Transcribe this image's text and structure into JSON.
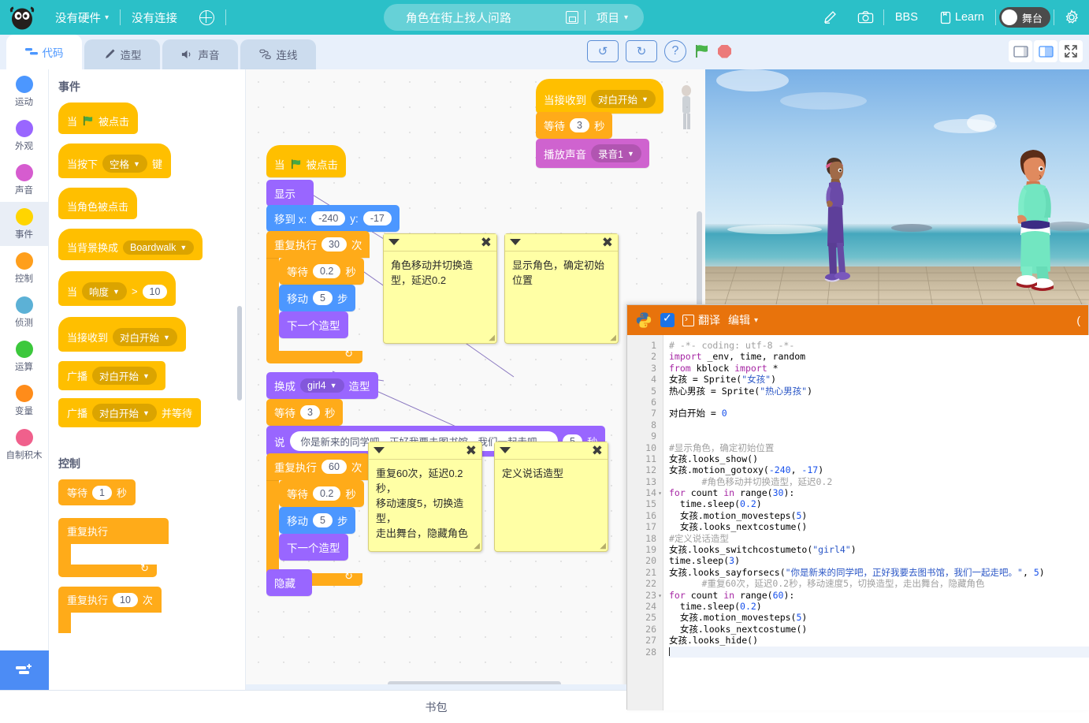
{
  "menubar": {
    "hardware": "没有硬件",
    "connection": "没有连接",
    "globe_icon": "globe-icon",
    "project_title": "角色在街上找人问路",
    "save_icon": "save-icon",
    "project_menu": "项目",
    "edit_icon": "pencil-icon",
    "camera_icon": "camera-icon",
    "bbs": "BBS",
    "learn": "Learn",
    "learn_icon": "book-icon",
    "stage_toggle": "舞台",
    "settings_icon": "gear-icon"
  },
  "tabs": [
    {
      "label": "代码",
      "icon": "code-icon",
      "active": true
    },
    {
      "label": "造型",
      "icon": "brush-icon",
      "active": false
    },
    {
      "label": "声音",
      "icon": "speaker-icon",
      "active": false
    },
    {
      "label": "连线",
      "icon": "link-icon",
      "active": false
    }
  ],
  "center_tools": {
    "undo": "undo-icon",
    "redo": "redo-icon",
    "help": "?",
    "green_flag": "green-flag-icon",
    "stop": "stop-icon"
  },
  "right_tools": {
    "small_stage": "small-stage-icon",
    "large_stage": "large-stage-icon",
    "fullscreen": "fullscreen-icon"
  },
  "categories": [
    {
      "label": "运动",
      "color": "#4c97ff",
      "selected": false
    },
    {
      "label": "外观",
      "color": "#9966ff",
      "selected": false
    },
    {
      "label": "声音",
      "color": "#d65ccf",
      "selected": false
    },
    {
      "label": "事件",
      "color": "#ffd500",
      "selected": true
    },
    {
      "label": "控制",
      "color": "#ff9f1c",
      "selected": false
    },
    {
      "label": "侦测",
      "color": "#5cb1d6",
      "selected": false
    },
    {
      "label": "运算",
      "color": "#3cc83c",
      "selected": false
    },
    {
      "label": "变量",
      "color": "#ff8c1a",
      "selected": false
    },
    {
      "label": "自制积木",
      "color": "#f0608c",
      "selected": false
    }
  ],
  "add_extension_icon": "add-extension-icon",
  "palette": {
    "section_events": "事件",
    "section_control": "控制",
    "blocks": {
      "when_flag": {
        "pre": "当",
        "post": "被点击"
      },
      "when_key": {
        "pre": "当按下",
        "key": "空格",
        "post": "键"
      },
      "when_sprite_clicked": "当角色被点击",
      "when_backdrop": {
        "pre": "当背景换成",
        "value": "Boardwalk"
      },
      "when_loudness": {
        "pre": "当",
        "value": "响度",
        "op": ">",
        "num": "10"
      },
      "when_receive": {
        "pre": "当接收到",
        "value": "对白开始"
      },
      "broadcast": {
        "pre": "广播",
        "value": "对白开始"
      },
      "broadcast_wait": {
        "pre": "广播",
        "value": "对白开始",
        "post": "并等待"
      },
      "wait": {
        "pre": "等待",
        "num": "1",
        "post": "秒"
      },
      "forever": "重复执行",
      "repeat": {
        "pre": "重复执行",
        "num": "10",
        "post": "次"
      }
    }
  },
  "canvas": {
    "script_main": [
      {
        "type": "hat",
        "cls": "ev",
        "pre": "当",
        "flag": true,
        "post": "被点击"
      },
      {
        "type": "look",
        "text": "显示"
      },
      {
        "type": "mot",
        "pre": "移到 x:",
        "x": "-240",
        "mid": "y:",
        "y": "-17"
      },
      {
        "type": "ctl",
        "pre": "重复执行",
        "num": "30",
        "post": "次"
      },
      {
        "type": "ctl",
        "pre": "等待",
        "num": "0.2",
        "post": "秒"
      },
      {
        "type": "mot",
        "pre": "移动",
        "num": "5",
        "post": "步"
      },
      {
        "type": "look",
        "text": "下一个造型"
      },
      {
        "type": "look",
        "pre": "换成",
        "value": "girl4",
        "post": "造型"
      },
      {
        "type": "ctl",
        "pre": "等待",
        "num": "3",
        "post": "秒"
      },
      {
        "type": "look",
        "pre": "说",
        "msg": "你是新来的同学吧，正好我要去图书馆，我们一起走吧。",
        "num": "5",
        "post": "秒"
      },
      {
        "type": "ctl",
        "pre": "重复执行",
        "num": "60",
        "post": "次"
      },
      {
        "type": "ctl",
        "pre": "等待",
        "num": "0.2",
        "post": "秒"
      },
      {
        "type": "mot",
        "pre": "移动",
        "num": "5",
        "post": "步"
      },
      {
        "type": "look",
        "text": "下一个造型"
      },
      {
        "type": "look",
        "text": "隐藏"
      }
    ],
    "script_sound": {
      "hat_pre": "当接收到",
      "hat_value": "对白开始",
      "wait_pre": "等待",
      "wait_num": "3",
      "wait_post": "秒",
      "play_pre": "播放声音",
      "play_value": "录音1"
    },
    "comments": [
      {
        "text": "角色移动并切换造型，延迟0.2"
      },
      {
        "text": "显示角色，确定初始位置"
      },
      {
        "text": "重复60次，延迟0.2秒，\n移动速度5，切换造型，\n走出舞台，隐藏角色"
      },
      {
        "text": "定义说话造型"
      }
    ]
  },
  "python": {
    "title_translate": "翻译",
    "title_edit": "编辑",
    "python_icon": "python-logo-icon",
    "checkbox_icon": "checkbox-checked-icon",
    "terminal_icon": "terminal-icon",
    "lines": [
      {
        "n": 1,
        "fold": false,
        "html": "<span class='cmt'># -*- coding: utf-8 -*-</span>"
      },
      {
        "n": 2,
        "fold": false,
        "html": "<span class='kw'>import</span> _env, time, random"
      },
      {
        "n": 3,
        "fold": false,
        "html": "<span class='kw'>from</span> kblock <span class='kw'>import</span> *"
      },
      {
        "n": 4,
        "fold": false,
        "html": "女孩 = Sprite(<span class='str'>\"女孩\"</span>)"
      },
      {
        "n": 5,
        "fold": false,
        "html": "热心男孩 = Sprite(<span class='str'>\"热心男孩\"</span>)"
      },
      {
        "n": 6,
        "fold": false,
        "html": ""
      },
      {
        "n": 7,
        "fold": false,
        "html": "对白开始 = <span class='num2'>0</span>"
      },
      {
        "n": 8,
        "fold": false,
        "html": ""
      },
      {
        "n": 9,
        "fold": false,
        "html": ""
      },
      {
        "n": 10,
        "fold": false,
        "html": "<span class='cmt'>#显示角色，确定初始位置</span>"
      },
      {
        "n": 11,
        "fold": false,
        "html": "女孩.looks_show()"
      },
      {
        "n": 12,
        "fold": false,
        "html": "女孩.motion_gotoxy(<span class='num2'>-240</span>, <span class='num2'>-17</span>)"
      },
      {
        "n": 13,
        "fold": false,
        "html": "      <span class='cmt'>#角色移动并切换造型，延迟0.2</span>"
      },
      {
        "n": 14,
        "fold": true,
        "html": "<span class='kw'>for</span> count <span class='kw'>in</span> range(<span class='num2'>30</span>):"
      },
      {
        "n": 15,
        "fold": false,
        "html": "  time.sleep(<span class='num2'>0.2</span>)"
      },
      {
        "n": 16,
        "fold": false,
        "html": "  女孩.motion_movesteps(<span class='num2'>5</span>)"
      },
      {
        "n": 17,
        "fold": false,
        "html": "  女孩.looks_nextcostume()"
      },
      {
        "n": 18,
        "fold": false,
        "html": "<span class='cmt'>#定义说话造型</span>"
      },
      {
        "n": 19,
        "fold": false,
        "html": "女孩.looks_switchcostumeto(<span class='str'>\"girl4\"</span>)"
      },
      {
        "n": 20,
        "fold": false,
        "html": "time.sleep(<span class='num2'>3</span>)"
      },
      {
        "n": 21,
        "fold": false,
        "html": "女孩.looks_sayforsecs(<span class='str'>\"你是新来的同学吧，正好我要去图书馆，我们一起走吧。\"</span>, <span class='num2'>5</span>)"
      },
      {
        "n": 22,
        "fold": false,
        "html": "      <span class='cmt'>#重复60次，延迟0.2秒，移动速度5，切换造型，走出舞台，隐藏角色</span>"
      },
      {
        "n": 23,
        "fold": true,
        "html": "<span class='kw'>for</span> count <span class='kw'>in</span> range(<span class='num2'>60</span>):"
      },
      {
        "n": 24,
        "fold": false,
        "html": "  time.sleep(<span class='num2'>0.2</span>)"
      },
      {
        "n": 25,
        "fold": false,
        "html": "  女孩.motion_movesteps(<span class='num2'>5</span>)"
      },
      {
        "n": 26,
        "fold": false,
        "html": "  女孩.looks_nextcostume()"
      },
      {
        "n": 27,
        "fold": false,
        "html": "女孩.looks_hide()"
      },
      {
        "n": 28,
        "fold": false,
        "html": "<span class='caret2'></span>",
        "current": true
      }
    ]
  },
  "bottom": {
    "label": "书包"
  },
  "colors": {
    "brand": "#2bc0c8",
    "accent": "#4c97ff",
    "events": "#ffbf00",
    "control": "#ffab19",
    "looks": "#9966ff",
    "motion": "#4c97ff",
    "sound": "#cf63cf",
    "python_header": "#e8730c"
  }
}
